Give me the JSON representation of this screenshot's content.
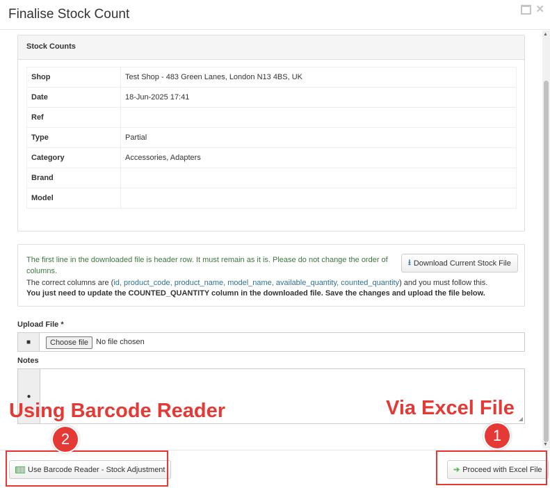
{
  "modal": {
    "title": "Finalise Stock Count"
  },
  "stock_counts": {
    "heading": "Stock Counts",
    "rows": [
      {
        "label": "Shop",
        "value": "Test Shop - 483 Green Lanes, London N13 4BS, UK"
      },
      {
        "label": "Date",
        "value": "18-Jun-2025 17:41"
      },
      {
        "label": "Ref",
        "value": ""
      },
      {
        "label": "Type",
        "value": "Partial"
      },
      {
        "label": "Category",
        "value": "Accessories, Adapters"
      },
      {
        "label": "Brand",
        "value": ""
      },
      {
        "label": "Model",
        "value": ""
      }
    ]
  },
  "info": {
    "line1": "The first line in the downloaded file is header row. It must remain as it is. Please do not change the order of columns.",
    "line2_prefix": "The correct columns are (",
    "columns": "id, product_code, product_name, model_name, available_quantity, counted_quantity",
    "line2_suffix": ") and you must follow this.",
    "line3": "You just need to update the COUNTED_QUANTITY column in the downloaded file. Save the changes and upload the file below.",
    "download_button": "Download Current Stock File"
  },
  "upload": {
    "label": "Upload File *",
    "choose_button": "Choose file",
    "no_file_text": "No file chosen"
  },
  "notes": {
    "label": "Notes"
  },
  "footer": {
    "barcode_button": "Use Barcode Reader - Stock Adjustment",
    "excel_button": "Proceed with Excel File"
  },
  "annotations": {
    "barcode_label": "Using Barcode Reader",
    "excel_label": "Via Excel File",
    "badge_barcode": "2",
    "badge_excel": "1",
    "color": "#e53935"
  }
}
